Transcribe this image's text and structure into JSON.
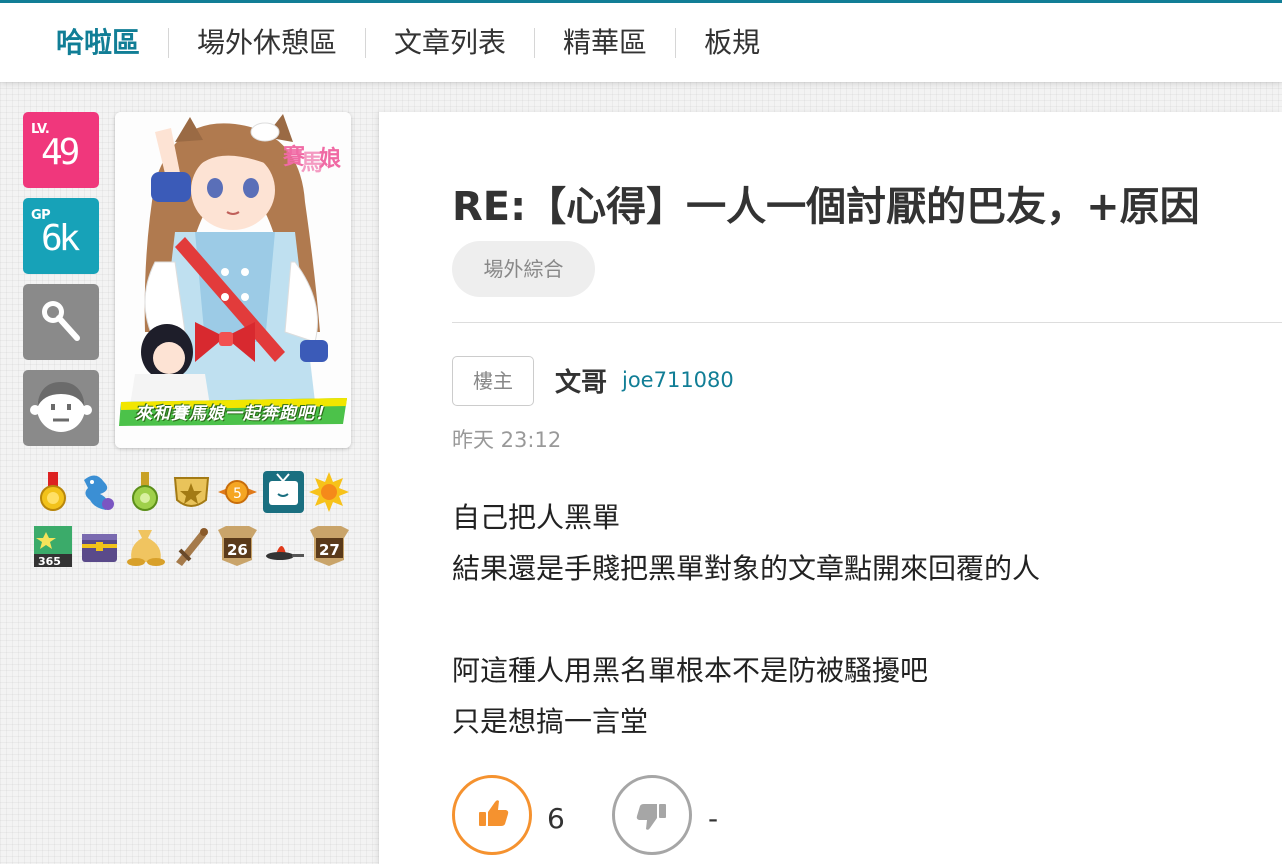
{
  "nav": {
    "items": [
      {
        "label": "哈啦區"
      },
      {
        "label": "場外休憩區"
      },
      {
        "label": "文章列表"
      },
      {
        "label": "精華區"
      },
      {
        "label": "板規"
      }
    ],
    "accent_color": "#117e96"
  },
  "user_panel": {
    "level_label": "LV.",
    "level_value": "49",
    "gp_label": "GP",
    "gp_value": "6k",
    "tools": [
      "magnifier-icon",
      "face-avatar-icon"
    ],
    "avatar_banner": "來和賽馬娘一起奔跑吧！",
    "medals_row1": [
      "gold-medal-icon",
      "dragon-icon",
      "green-medal-icon",
      "star-shield-icon",
      "coin-icon",
      "tv-icon",
      "sun-icon"
    ],
    "medals_row2": [
      "flag-365-icon",
      "treasure-chest-icon",
      "money-bag-icon",
      "sword-icon",
      "banner-26-icon",
      "frying-pan-icon",
      "banner-27-icon"
    ],
    "medal_numbers": {
      "flag": "365",
      "banner_a": "26",
      "banner_b": "27"
    }
  },
  "post": {
    "title": "RE:【心得】一人一個討厭的巴友，+原因",
    "board_tag": "場外綜合",
    "floor_tag": "樓主",
    "author_name": "文哥",
    "author_id": "joe711080",
    "time": "昨天 23:12",
    "content_lines": [
      "自己把人黑單",
      "結果還是手賤把黑單對象的文章點開來回覆的人",
      "",
      "阿這種人用黑名單根本不是防被騷擾吧",
      "只是想搞一言堂"
    ],
    "like_count": "6",
    "dislike_count": "-",
    "like_color": "#f5922f",
    "dislike_color": "#a6a6a6"
  }
}
